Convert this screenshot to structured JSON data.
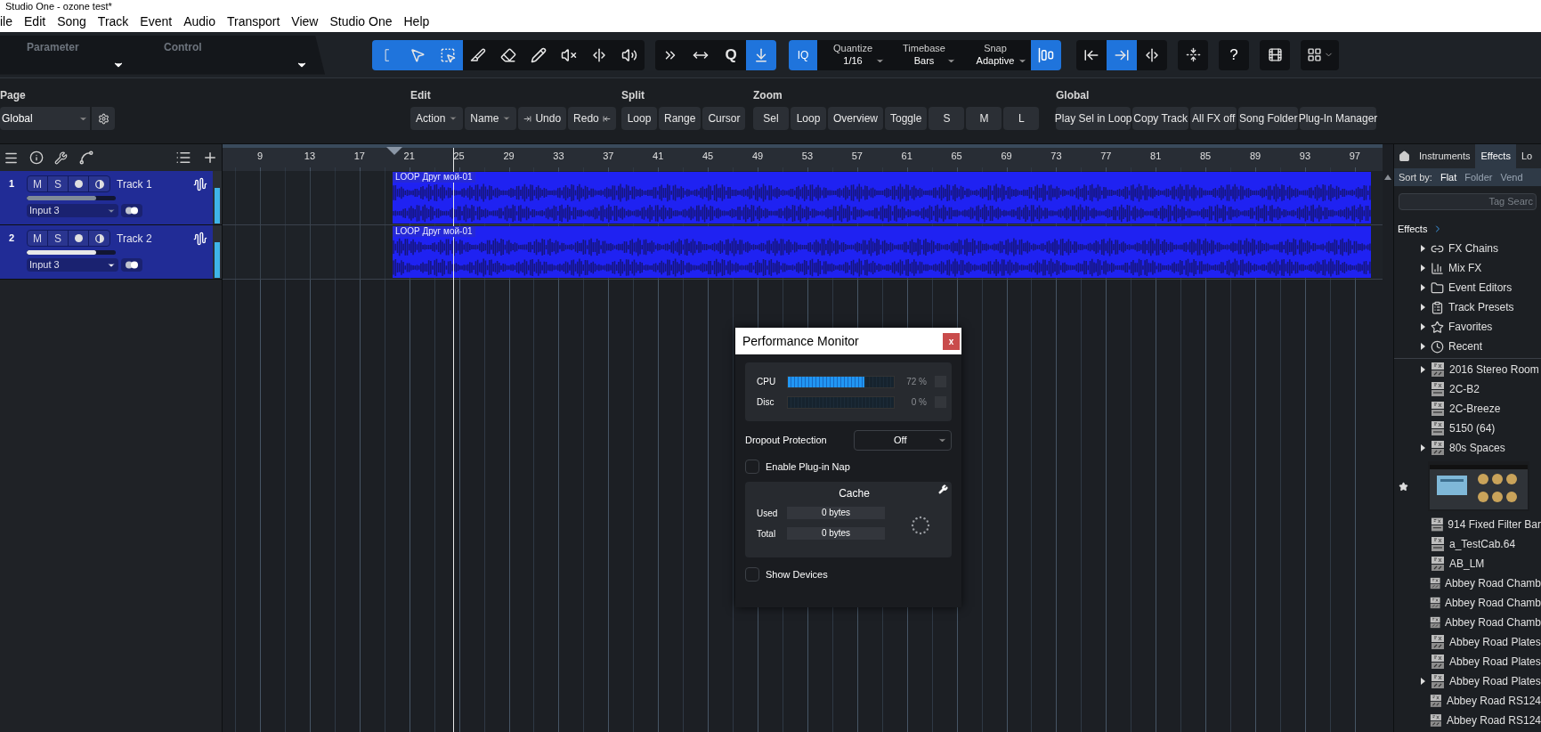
{
  "window": {
    "title": "Studio One - ozone test*"
  },
  "menu": [
    {
      "label": "ile"
    },
    {
      "label": "Edit"
    },
    {
      "label": "Song"
    },
    {
      "label": "Track"
    },
    {
      "label": "Event"
    },
    {
      "label": "Audio"
    },
    {
      "label": "Transport"
    },
    {
      "label": "View"
    },
    {
      "label": "Studio One"
    },
    {
      "label": "Help"
    }
  ],
  "toolbar": {
    "parameter": "Parameter",
    "control": "Control",
    "tools": [
      {
        "kind": "range",
        "selected": true
      },
      {
        "kind": "arrow",
        "selected": true
      },
      {
        "kind": "select",
        "selected": true
      },
      {
        "kind": "knife",
        "selected": false
      },
      {
        "kind": "eraser",
        "selected": false
      },
      {
        "kind": "pencil",
        "selected": false
      },
      {
        "kind": "mute",
        "selected": false
      },
      {
        "kind": "split",
        "selected": false
      },
      {
        "kind": "listen",
        "selected": false
      }
    ],
    "edit_tools": [
      {
        "kind": "bend",
        "selected": false
      },
      {
        "kind": "stretch",
        "selected": false
      },
      {
        "kind": "quantize",
        "label": "Q",
        "selected": false
      },
      {
        "kind": "autoscroll",
        "selected": true
      }
    ],
    "iq": {
      "label": "IQ",
      "selected": true
    },
    "settings": [
      {
        "label": "Quantize",
        "value": "1/16"
      },
      {
        "label": "Timebase",
        "value": "Bars"
      },
      {
        "label": "Snap",
        "value": "Adaptive"
      }
    ],
    "snap": {
      "selected": true
    },
    "view_tools": [
      {
        "kind": "left",
        "selected": false
      },
      {
        "kind": "right",
        "selected": true
      },
      {
        "kind": "center",
        "selected": false
      }
    ],
    "buttons": [
      {
        "kind": "fold"
      },
      {
        "kind": "help",
        "label": "?"
      },
      {
        "kind": "video"
      },
      {
        "kind": "grid"
      }
    ]
  },
  "macro_bar": {
    "page": {
      "label": "Page",
      "value": "Global"
    },
    "groups": [
      {
        "title": "Edit",
        "buttons": [
          {
            "label": "Action",
            "kind": "dropdown"
          },
          {
            "label": "Name",
            "kind": "dropdown"
          },
          {
            "label": "Undo",
            "kind": "undo"
          },
          {
            "label": "Redo",
            "kind": "redo"
          }
        ]
      },
      {
        "title": "Split",
        "buttons": [
          {
            "label": "Loop",
            "kind": "plain"
          },
          {
            "label": "Range",
            "kind": "plain"
          },
          {
            "label": "Cursor",
            "kind": "plain"
          }
        ]
      },
      {
        "title": "Zoom",
        "buttons": [
          {
            "label": "Sel",
            "kind": "plain"
          },
          {
            "label": "Loop",
            "kind": "plain"
          },
          {
            "label": "Overview",
            "kind": "plain"
          },
          {
            "label": "Toggle",
            "kind": "plain"
          },
          {
            "label": "S",
            "kind": "plain"
          },
          {
            "label": "M",
            "kind": "plain"
          },
          {
            "label": "L",
            "kind": "plain"
          }
        ]
      },
      {
        "title": "Global",
        "buttons": [
          {
            "label": "Play Sel in Loop",
            "kind": "plain"
          },
          {
            "label": "Copy Track",
            "kind": "plain"
          },
          {
            "label": "All FX off",
            "kind": "plain"
          },
          {
            "label": "Song Folder",
            "kind": "plain"
          },
          {
            "label": "Plug-In Manager",
            "kind": "plain"
          }
        ]
      }
    ]
  },
  "ruler": {
    "bars": [
      "9",
      "13",
      "17",
      "21",
      "25",
      "29",
      "33",
      "37",
      "41",
      "45",
      "49",
      "53",
      "57",
      "61",
      "65",
      "69",
      "73",
      "77",
      "81",
      "85",
      "89",
      "93",
      "97"
    ]
  },
  "tracks": [
    {
      "number": "1",
      "name": "Track 1",
      "mute": "M",
      "solo": "S",
      "input": "Input 3",
      "link_on": true,
      "level": 0.78,
      "selected": false,
      "clip": {
        "title": "LOOP Друг мой-01"
      }
    },
    {
      "number": "2",
      "name": "Track 2",
      "mute": "M",
      "solo": "S",
      "input": "Input 3",
      "link_on": true,
      "level": 0.78,
      "selected": true,
      "clip": {
        "title": "LOOP Друг мой-01"
      }
    }
  ],
  "performance_monitor": {
    "title": "Performance Monitor",
    "close": "x",
    "meters": [
      {
        "label": "CPU",
        "level": 0.72,
        "reading": "72 %"
      },
      {
        "label": "Disc",
        "level": 0,
        "reading": "0 %"
      }
    ],
    "dropout": {
      "label": "Dropout Protection",
      "value": "Off"
    },
    "plugin_nap": {
      "label": "Enable Plug-in Nap",
      "checked": false
    },
    "cache": {
      "title": "Cache",
      "rows": [
        {
          "label": "Used",
          "value": "0 bytes"
        },
        {
          "label": "Total",
          "value": "0 bytes"
        }
      ]
    },
    "show_devices": {
      "label": "Show Devices",
      "checked": false
    }
  },
  "browser": {
    "tabs": [
      {
        "label": "Instruments",
        "selected": false
      },
      {
        "label": "Effects",
        "selected": true
      },
      {
        "label": "Lo",
        "selected": false
      }
    ],
    "sort_label": "Sort by:",
    "sort_options": [
      {
        "label": "Flat",
        "selected": true
      },
      {
        "label": "Folder",
        "selected": false
      },
      {
        "label": "Vend",
        "selected": false
      }
    ],
    "search": {
      "placeholder": "Tag Searc"
    },
    "breadcrumb": "Effects",
    "folders": [
      {
        "label": "FX Chains",
        "kind": "chains",
        "expandable": true
      },
      {
        "label": "Mix FX",
        "kind": "mixfx",
        "expandable": true
      },
      {
        "label": "Event Editors",
        "kind": "editors",
        "expandable": true
      },
      {
        "label": "Track Presets",
        "kind": "presets",
        "expandable": true
      },
      {
        "label": "Favorites",
        "kind": "favorites",
        "expandable": true
      },
      {
        "label": "Recent",
        "kind": "recent",
        "expandable": true
      }
    ],
    "items": [
      {
        "label": "2016 Stereo Room",
        "kind": "fx",
        "expandable": true
      },
      {
        "label": "2C-B2",
        "kind": "vst",
        "expandable": false
      },
      {
        "label": "2C-Breeze",
        "kind": "vst",
        "expandable": false
      },
      {
        "label": "5150 (64)",
        "kind": "vst",
        "expandable": false
      },
      {
        "label": "80s Spaces",
        "kind": "fx",
        "expandable": true
      },
      {
        "kind": "preview",
        "starred": true
      },
      {
        "label": "914 Fixed Filter Bar",
        "kind": "vst",
        "expandable": false
      },
      {
        "label": "a_TestCab.64",
        "kind": "vst",
        "expandable": false
      },
      {
        "label": "AB_LM",
        "kind": "fx",
        "expandable": false
      },
      {
        "label": "Abbey Road Chamb",
        "kind": "fx",
        "expandable": false
      },
      {
        "label": "Abbey Road Chamb",
        "kind": "fx",
        "expandable": false
      },
      {
        "label": "Abbey Road Chamb",
        "kind": "fx",
        "expandable": false
      },
      {
        "label": "Abbey Road Plates",
        "kind": "fx",
        "expandable": false
      },
      {
        "label": "Abbey Road Plates",
        "kind": "fx",
        "expandable": false
      },
      {
        "label": "Abbey Road Plates",
        "kind": "fx",
        "expandable": true
      },
      {
        "label": "Abbey Road RS124",
        "kind": "fx",
        "expandable": false
      },
      {
        "label": "Abbey Road RS124",
        "kind": "fx",
        "expandable": false
      }
    ]
  }
}
